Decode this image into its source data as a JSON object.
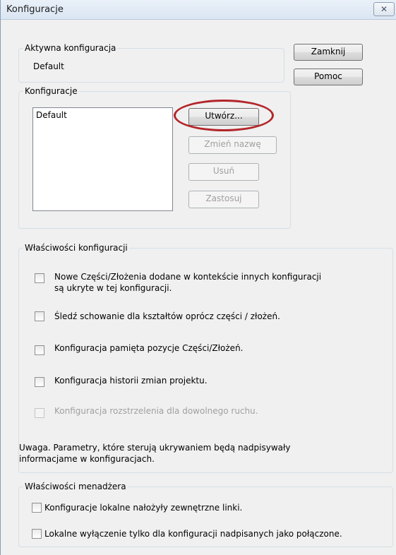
{
  "window": {
    "title": "Konfiguracje",
    "close_glyph": "✕"
  },
  "active": {
    "legend": "Aktywna konfiguracja",
    "value": "Default"
  },
  "buttons": {
    "close": "Zamknij",
    "help": "Pomoc"
  },
  "configs": {
    "legend": "Konfiguracje",
    "list_items": [
      "Default"
    ],
    "create": "Utwórz...",
    "rename": "Zmień nazwę",
    "delete": "Usuń",
    "apply": "Zastosuj"
  },
  "properties": {
    "legend": "Właściwości konfiguracji",
    "items": [
      {
        "label_line1": "Nowe Części/Złożenia dodane w kontekście innych konfiguracji",
        "label_line2": "są ukryte w tej konfiguracji.",
        "checked": false,
        "enabled": true
      },
      {
        "label_line1": "Śledź schowanie dla kształtów oprócz części / złożeń.",
        "checked": false,
        "enabled": true
      },
      {
        "label_line1": "Konfiguracja pamięta pozycje Części/Złożeń.",
        "checked": false,
        "enabled": true
      },
      {
        "label_line1": "Konfiguracja historii zmian projektu.",
        "checked": false,
        "enabled": true
      },
      {
        "label_line1": "Konfiguracja rozstrzelenia dla dowolnego ruchu.",
        "checked": false,
        "enabled": false
      }
    ],
    "note_line1": "Uwaga. Parametry, które sterują ukrywaniem będą nadpisywały",
    "note_line2": "informacjame w konfiguracjach."
  },
  "manager": {
    "legend": "Właściwości menadżera",
    "items": [
      {
        "label": "Konfiguracje lokalne nałożyły zewnętrzne linki.",
        "checked": false
      },
      {
        "label": "Lokalne wyłączenie tylko dla konfiguracji nadpisanych jako połączone.",
        "checked": false
      }
    ]
  },
  "annotation": {
    "highlight_color": "#b3262a",
    "target": "configs.create"
  }
}
